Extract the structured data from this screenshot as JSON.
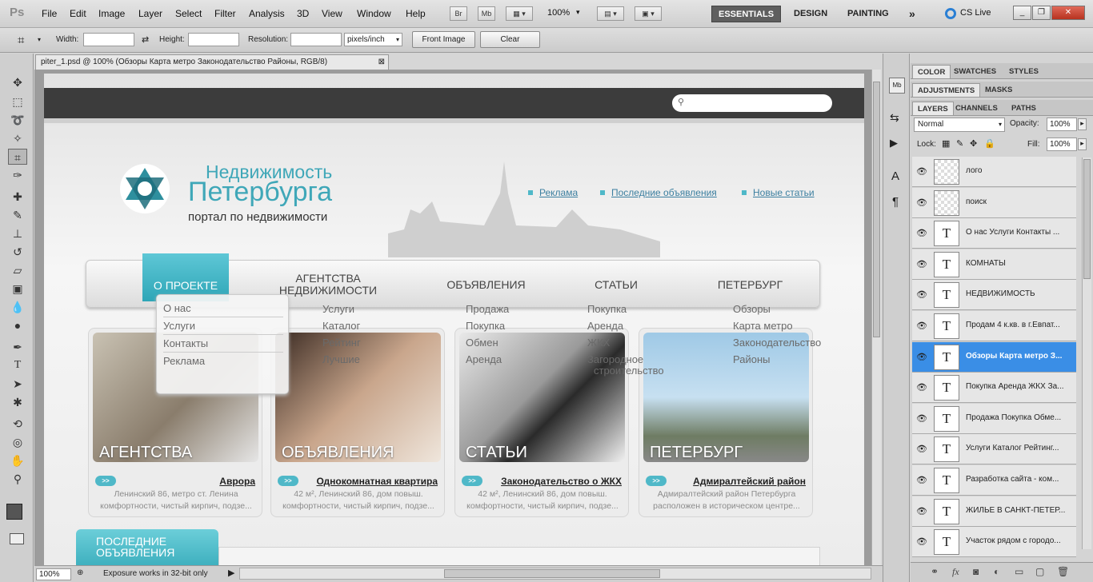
{
  "app": {
    "logo": "Ps"
  },
  "menu": [
    "File",
    "Edit",
    "Image",
    "Layer",
    "Select",
    "Filter",
    "Analysis",
    "3D",
    "View",
    "Window",
    "Help"
  ],
  "toolbar": {
    "br": "Br",
    "mb": "Mb",
    "zoom": "100%"
  },
  "workspaces": {
    "essentials": "ESSENTIALS",
    "design": "DESIGN",
    "painting": "PAINTING",
    "more": "»",
    "cslive": "CS Live"
  },
  "options": {
    "width_label": "Width:",
    "height_label": "Height:",
    "resolution_label": "Resolution:",
    "unit": "pixels/inch",
    "front_image": "Front Image",
    "clear": "Clear"
  },
  "document": {
    "tab_title": "piter_1.psd @ 100% (Обзоры Карта метро Законодательство Районы, RGB/8)"
  },
  "panels": {
    "row1": [
      "COLOR",
      "SWATCHES",
      "STYLES"
    ],
    "row2": [
      "ADJUSTMENTS",
      "MASKS"
    ],
    "row3": [
      "LAYERS",
      "CHANNELS",
      "PATHS"
    ],
    "blend_mode": "Normal",
    "opacity_label": "Opacity:",
    "opacity": "100%",
    "lock_label": "Lock:",
    "fill_label": "Fill:",
    "fill": "100%"
  },
  "layers": [
    {
      "name": "лого",
      "type": "image"
    },
    {
      "name": "поиск",
      "type": "image"
    },
    {
      "name": "О нас Услуги Контакты ...",
      "type": "text"
    },
    {
      "name": "КОМНАТЫ",
      "type": "text"
    },
    {
      "name": "НЕДВИЖИМОСТЬ",
      "type": "text"
    },
    {
      "name": "Продам 4 к.кв. в г.Евпат...",
      "type": "text"
    },
    {
      "name": "Обзоры Карта метро З...",
      "type": "text",
      "active": true
    },
    {
      "name": "Покупка Аренда ЖКХ За...",
      "type": "text"
    },
    {
      "name": "Продажа Покупка Обме...",
      "type": "text"
    },
    {
      "name": "Услуги Каталог Рейтинг...",
      "type": "text"
    },
    {
      "name": "Разработка сайта -  ком...",
      "type": "text"
    },
    {
      "name": "ЖИЛЬЕ В САНКТ-ПЕТЕР...",
      "type": "text"
    },
    {
      "name": "Участок рядом с городо...",
      "type": "text"
    }
  ],
  "status": {
    "zoom": "100%",
    "message": "Exposure works in 32-bit only"
  },
  "site": {
    "brand_line1": "Недвижимость",
    "brand_line2": "Петербурга",
    "brand_tagline": "портал по недвижимости",
    "top_links": [
      "Реклама",
      "Последние объявления",
      "Новые статьи"
    ],
    "nav": [
      "О ПРОЕКТЕ",
      "АГЕНТСТВА\nНЕДВИЖИМОСТИ",
      "ОБЪЯВЛЕНИЯ",
      "СТАТЬИ",
      "ПЕТЕРБУРГ"
    ],
    "dropdown": [
      "О нас",
      "Услуги",
      "Контакты",
      "Реклама"
    ],
    "sub2": [
      "Услуги",
      "Каталог",
      "Рейтинг",
      "Лучшие"
    ],
    "sub3": [
      "Продажа",
      "Покупка",
      "Обмен",
      "Аренда"
    ],
    "sub4": [
      "Покупка",
      "Аренда",
      "ЖКХ",
      "Загородное",
      "строительство"
    ],
    "sub5": [
      "Обзоры",
      "Карта метро",
      "Законодательство",
      "Районы"
    ],
    "cards": [
      {
        "caption": "АГЕНТСТВА",
        "link": "Аврора",
        "desc1": "Ленинский 86, метро ст. Ленина",
        "desc2": "комфортности, чистый кирпич, подзе..."
      },
      {
        "caption": "ОБЪЯВЛЕНИЯ",
        "link": "Однокомнатная квартира",
        "desc1": "42 м², Ленинский 86, дом повыш.",
        "desc2": "комфортности, чистый кирпич, подзе..."
      },
      {
        "caption": "СТАТЬИ",
        "link": "Законодательство о ЖКХ",
        "desc1": "42 м², Ленинский 86, дом повыш.",
        "desc2": "комфортности, чистый кирпич, подзе..."
      },
      {
        "caption": "ПЕТЕРБУРГ",
        "link": "Адмиралтейский район",
        "desc1": "Адмиралтейский район Петербурга",
        "desc2": "расположен в историческом центре..."
      }
    ],
    "arrow": ">>",
    "latest_line1": "ПОСЛЕДНИЕ",
    "latest_line2": "ОБЪЯВЛЕНИЯ"
  }
}
